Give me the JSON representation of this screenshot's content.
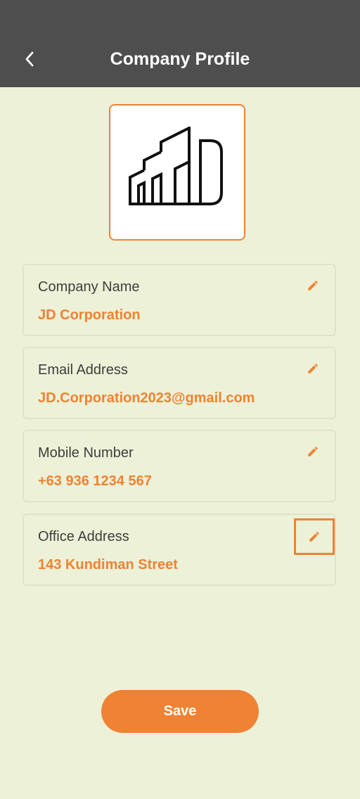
{
  "header": {
    "title": "Company Profile",
    "back_icon": "chevron-left-icon"
  },
  "logo": {
    "icon": "company-logo-building-jd"
  },
  "fields": [
    {
      "label": "Company Name",
      "value": "JD Corporation",
      "edit_icon": "pencil-icon"
    },
    {
      "label": "Email Address",
      "value": "JD.Corporation2023@gmail.com",
      "edit_icon": "pencil-icon"
    },
    {
      "label": "Mobile Number",
      "value": "+63 936 1234 567",
      "edit_icon": "pencil-icon"
    },
    {
      "label": "Office Address",
      "value": "143 Kundiman Street",
      "edit_icon": "pencil-icon"
    }
  ],
  "save_button": {
    "label": "Save"
  },
  "colors": {
    "accent": "#ef8233",
    "header_bg": "#4f4e4f",
    "page_bg": "#edf1d7",
    "label_text": "#3e3e3e"
  }
}
